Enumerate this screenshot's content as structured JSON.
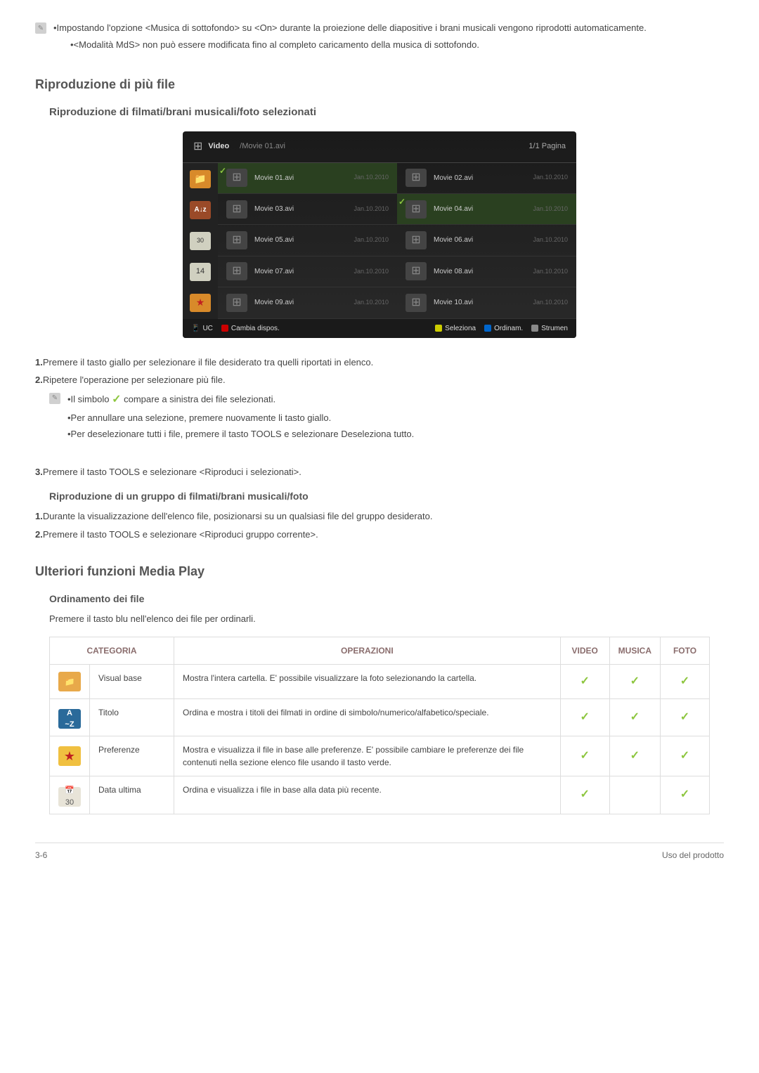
{
  "top_notes": [
    "•Impostando l'opzione <Musica di sottofondo> su <On> durante la proiezione delle diapositive i brani musicali vengono riprodotti automaticamente.",
    "•<Modalità MdS> non può essere modificata fino al completo caricamento della musica di sottofondo."
  ],
  "h2_repro": "Riproduzione di più file",
  "h3_repro_sel": "Riproduzione di filmati/brani musicali/foto selezionati",
  "ui": {
    "category": "Video",
    "path": "/Movie 01.avi",
    "page": "1/1 Pagina",
    "sidebar_cal": "30",
    "sidebar_num": "14",
    "files": [
      {
        "name": "Movie 01.avi",
        "date": "Jan.10.2010",
        "sel": true
      },
      {
        "name": "Movie 02.avi",
        "date": "Jan.10.2010",
        "sel": false
      },
      {
        "name": "Movie 03.avi",
        "date": "Jan.10.2010",
        "sel": false
      },
      {
        "name": "Movie 04.avi",
        "date": "Jan.10.2010",
        "sel": true
      },
      {
        "name": "Movie 05.avi",
        "date": "Jan.10.2010",
        "sel": false
      },
      {
        "name": "Movie 06.avi",
        "date": "Jan.10.2010",
        "sel": false
      },
      {
        "name": "Movie 07.avi",
        "date": "Jan.10.2010",
        "sel": false
      },
      {
        "name": "Movie 08.avi",
        "date": "Jan.10.2010",
        "sel": false
      },
      {
        "name": "Movie 09.avi",
        "date": "Jan.10.2010",
        "sel": false
      },
      {
        "name": "Movie 10.avi",
        "date": "Jan.10.2010",
        "sel": false
      }
    ],
    "footer_device": "UC",
    "footer_a": "Cambia dispos.",
    "footer_sel": "Seleziona",
    "footer_sort": "Ordinam.",
    "footer_tools": "Strumen"
  },
  "step1": "Premere il tasto giallo per selezionare il file desiderato tra quelli riportati in elenco.",
  "step2": "Ripetere l'operazione per selezionare più file.",
  "sym_note_pre": "•Il simbolo",
  "sym_note_post": "compare a sinistra dei file selezionati.",
  "sym_note2": "•Per annullare una selezione, premere nuovamente li tasto giallo.",
  "sym_note3": "•Per deselezionare tutti i file, premere il tasto TOOLS e selezionare Deseleziona tutto.",
  "step3": "Premere il tasto TOOLS e selezionare <Riproduci i selezionati>.",
  "h4_group": "Riproduzione di un gruppo di filmati/brani musicali/foto",
  "group1": "Durante la visualizzazione dell'elenco file, posizionarsi su un qualsiasi file del gruppo desiderato.",
  "group2": "Premere il tasto TOOLS e selezionare <Riproduci gruppo corrente>.",
  "h2_more": "Ulteriori funzioni Media Play",
  "h4_sort": "Ordinamento dei file",
  "sort_intro": "Premere il tasto blu nell'elenco dei file per ordinarli.",
  "table": {
    "headers": {
      "cat": "CATEGORIA",
      "op": "OPERAZIONI",
      "video": "VIDEO",
      "music": "MUSICA",
      "photo": "FOTO"
    },
    "rows": [
      {
        "name": "Visual base",
        "desc": "Mostra l'intera cartella. E' possibile visualizzare la foto selezionando la cartella.",
        "v": true,
        "m": true,
        "p": true,
        "icon": "folder"
      },
      {
        "name": "Titolo",
        "desc": "Ordina e mostra i titoli dei filmati in ordine di simbolo/numerico/alfabetico/speciale.",
        "v": true,
        "m": true,
        "p": true,
        "icon": "az"
      },
      {
        "name": "Preferenze",
        "desc": "Mostra e visualizza il file in base alle preferenze. E' possibile cambiare le preferenze dei file contenuti nella sezione elenco file usando il tasto verde.",
        "v": true,
        "m": true,
        "p": true,
        "icon": "star"
      },
      {
        "name": "Data ultima",
        "desc": "Ordina e visualizza i file in base alla data più recente.",
        "v": true,
        "m": false,
        "p": true,
        "icon": "cal"
      }
    ]
  },
  "footer_left": "3-6",
  "footer_right": "Uso del prodotto"
}
